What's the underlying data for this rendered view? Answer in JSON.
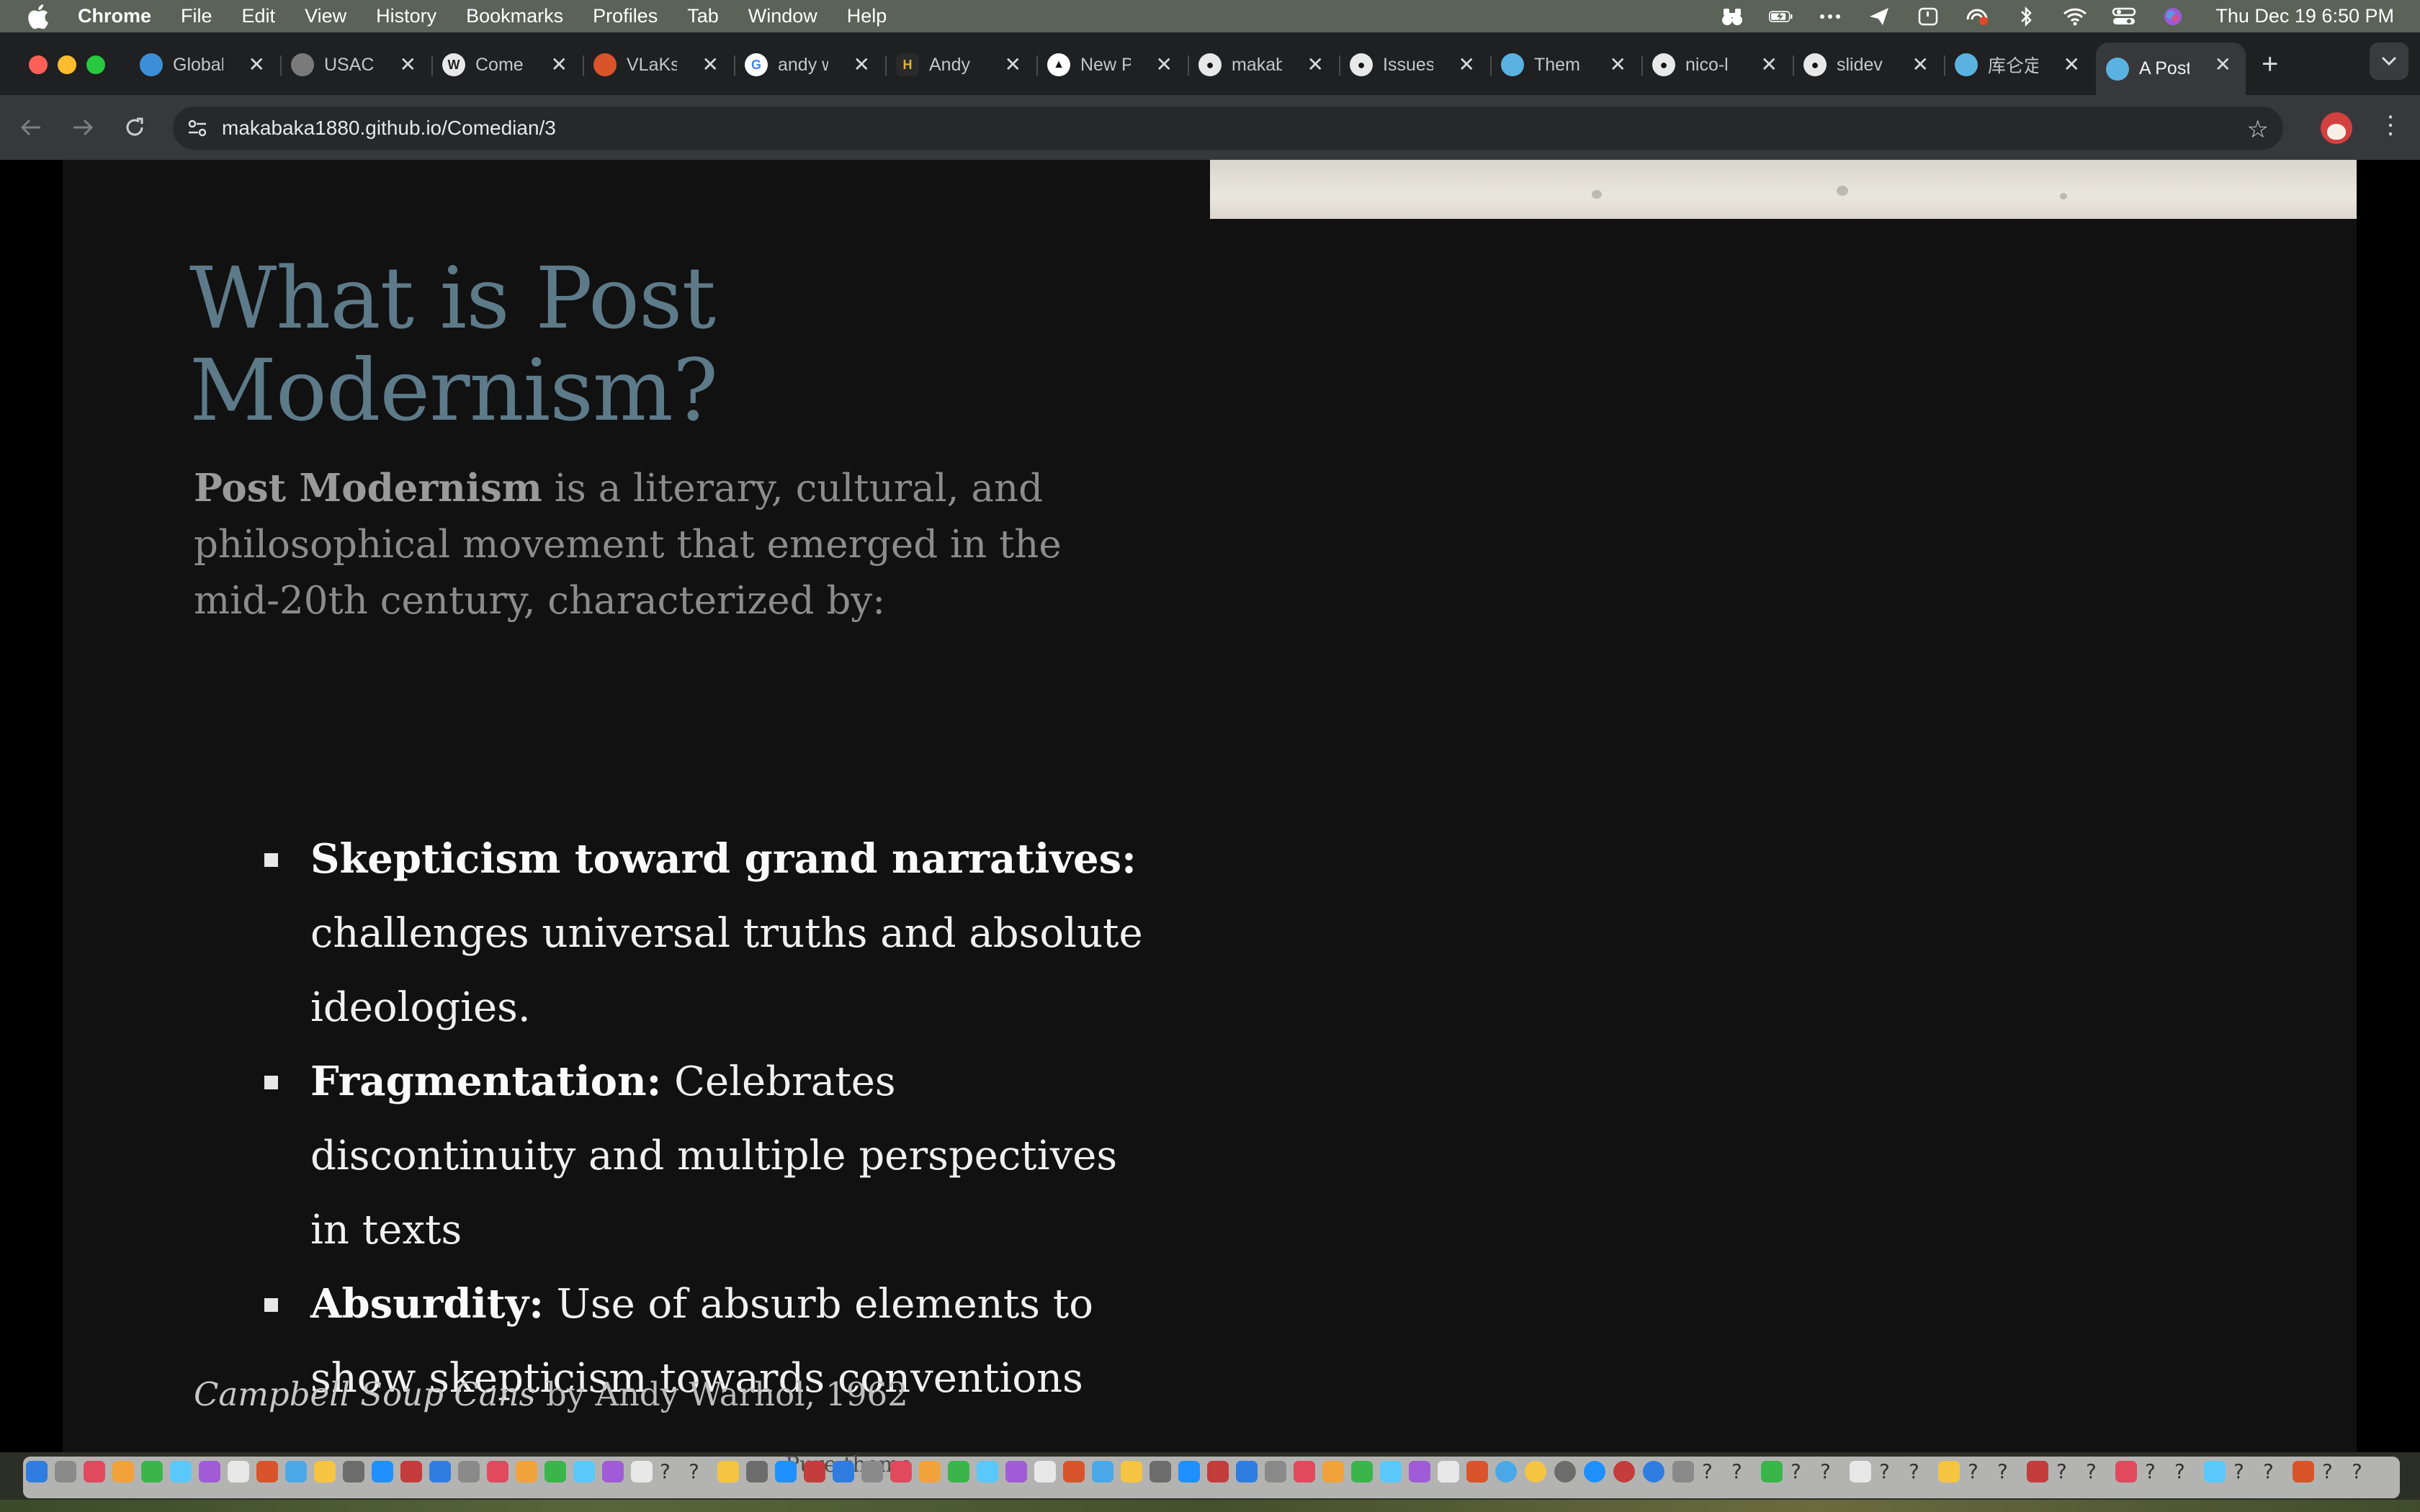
{
  "menubar": {
    "app_name": "Chrome",
    "items": [
      "File",
      "Edit",
      "View",
      "History",
      "Bookmarks",
      "Profiles",
      "Tab",
      "Window",
      "Help"
    ],
    "clock": "Thu Dec 19  6:50 PM"
  },
  "tabs": [
    {
      "label": "Global",
      "favicon": "globe-icon",
      "color": "#3b8fd8"
    },
    {
      "label": "USACO",
      "favicon": "usaco-icon",
      "color": "#7a7a7a"
    },
    {
      "label": "Come",
      "favicon": "wordpress-icon",
      "color": "#e8e8e8"
    },
    {
      "label": "VLaKs",
      "favicon": "vlaks-icon",
      "color": "#d9542b"
    },
    {
      "label": "andy w",
      "favicon": "google-icon",
      "color": "#4285f4"
    },
    {
      "label": "Andy",
      "favicon": "h-icon",
      "color": "#b8860b"
    },
    {
      "label": "New P",
      "favicon": "triangle-icon",
      "color": "#111111"
    },
    {
      "label": "makab",
      "favicon": "github-icon",
      "color": "#e8e8e8"
    },
    {
      "label": "Issues",
      "favicon": "github-icon",
      "color": "#e8e8e8"
    },
    {
      "label": "Them",
      "favicon": "globe-icon",
      "color": "#5ab2e0"
    },
    {
      "label": "nico-l",
      "favicon": "github-icon",
      "color": "#e8e8e8"
    },
    {
      "label": "slidev",
      "favicon": "github-icon",
      "color": "#e8e8e8"
    },
    {
      "label": "库仑定",
      "favicon": "globe-icon",
      "color": "#5ab2e0"
    },
    {
      "label": "A Post",
      "favicon": "globe-icon",
      "color": "#5ab2e0",
      "active": true
    }
  ],
  "toolbar": {
    "url": "makabaka1880.github.io/Comedian/3"
  },
  "slide": {
    "title": "What is Post Modernism?",
    "intro_bold": "Post Modernism",
    "intro_rest": " is a literary, cultural, and philosophical movement that emerged in the mid-20th century, characterized by:",
    "bullets": [
      {
        "bold": "Skepticism toward grand narratives:",
        "text": " challenges universal truths and absolute ideologies."
      },
      {
        "bold": "Fragmentation:",
        "text": " Celebrates discontinuity and multiple perspectives in texts"
      },
      {
        "bold": "Absurdity:",
        "text": " Use of absurb elements to show skepticism towards conventions"
      }
    ],
    "caption_italic": "Campbell Soup Cans",
    "caption_rest": " by Andy Warhol, 1962"
  },
  "dock": {
    "ghost_text": "Pure theme"
  },
  "colors": {
    "title": "#5d7a89",
    "slide_bg": "#111112",
    "accent_red": "#d43f3f"
  }
}
